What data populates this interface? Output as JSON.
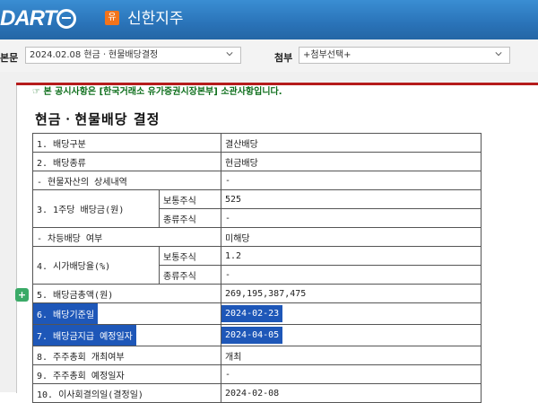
{
  "header": {
    "logo_text": "DART",
    "company_badge": "유",
    "company_name": "신한지주"
  },
  "toolbar": {
    "main_label": "본문",
    "main_select": "2024.02.08  현금ㆍ현물배당결정",
    "attach_label": "첨부",
    "attach_select": "+첨부선택+"
  },
  "notice": "☞ 본 공시사항은 [한국거래소 유가증권시장본부] 소관사항입니다.",
  "title": "현금ㆍ현물배당 결정",
  "rows": {
    "r1": {
      "label": "1. 배당구분",
      "value": "결산배당"
    },
    "r2": {
      "label": "2. 배당종류",
      "value": "현금배당"
    },
    "r3": {
      "label": "- 현물자산의 상세내역",
      "value": "-"
    },
    "r4": {
      "label": "3. 1주당 배당금(원)",
      "sub1": "보통주식",
      "val1": "525",
      "sub2": "종류주식",
      "val2": "-"
    },
    "r5": {
      "label": "- 차등배당 여부",
      "value": "미해당"
    },
    "r6": {
      "label": "4. 시가배당율(%)",
      "sub1": "보통주식",
      "val1": "1.2",
      "sub2": "종류주식",
      "val2": "-"
    },
    "r7": {
      "label": "5. 배당금총액(원)",
      "value": "269,195,387,475"
    },
    "r8": {
      "label": "6. 배당기준일",
      "value": "2024-02-23"
    },
    "r9": {
      "label": "7. 배당금지급 예정일자",
      "value": "2024-04-05"
    },
    "r10": {
      "label": "8. 주주총회 개최여부",
      "value": "개최"
    },
    "r11": {
      "label": "9. 주주총회 예정일자",
      "value": "-"
    },
    "r12": {
      "label": "10. 이사회결의일(결정일)",
      "value": "2024-02-08"
    }
  },
  "side_button": "+"
}
